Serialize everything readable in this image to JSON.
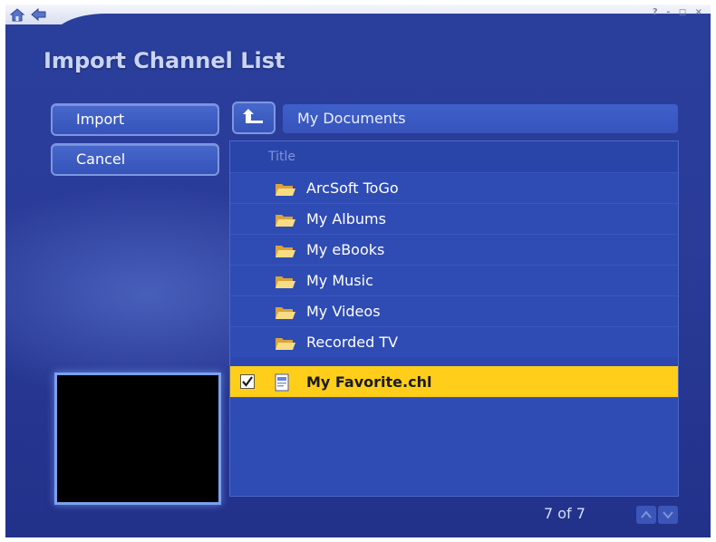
{
  "title": "Import Channel List",
  "window_controls": "? - ◻ ×",
  "buttons": {
    "import": "Import",
    "cancel": "Cancel"
  },
  "path": "My Documents",
  "list": {
    "header": "Title",
    "folders": [
      "ArcSoft ToGo",
      "My Albums",
      "My eBooks",
      "My Music",
      "My Videos",
      "Recorded TV"
    ],
    "selected_file": "My Favorite.chl"
  },
  "page_count": "7 of 7",
  "icons": {
    "home": "home-icon",
    "back": "back-icon",
    "up": "up-folder-icon",
    "folder": "folder-icon",
    "file": "channel-file-icon",
    "check": "checked-checkbox-icon"
  },
  "colors": {
    "selection": "#ffce1a",
    "background": "#2a3e9c"
  }
}
